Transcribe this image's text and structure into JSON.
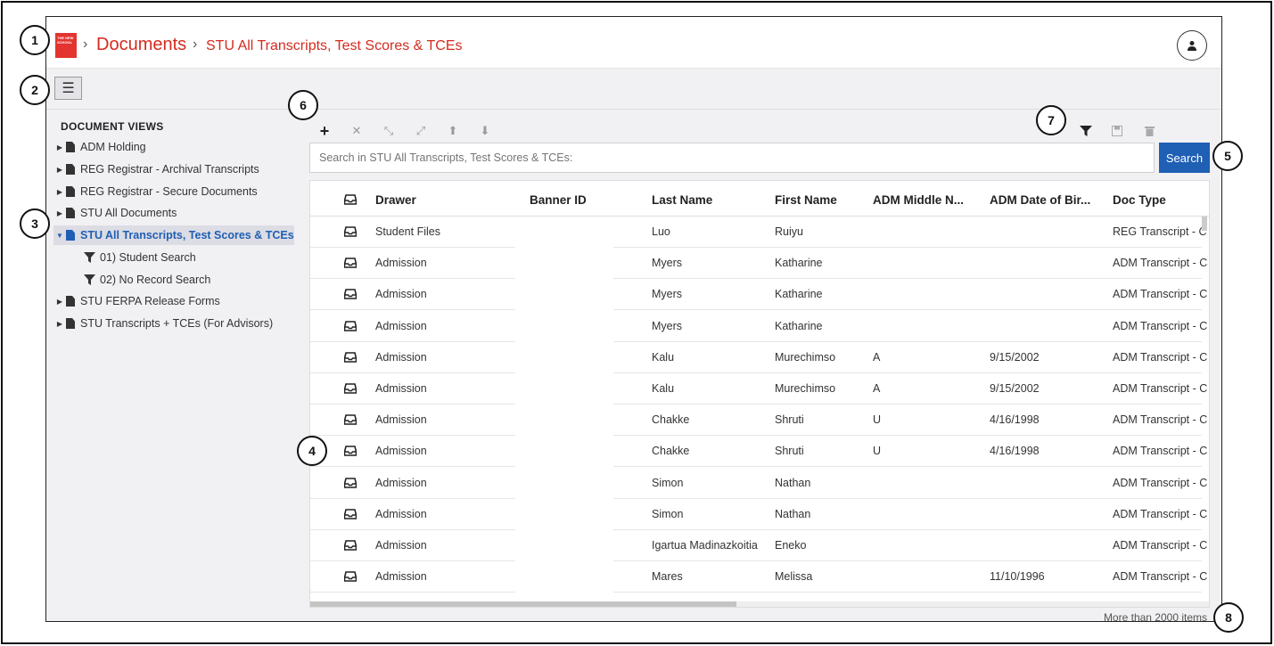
{
  "header": {
    "logo_text": "THE NEW SCHOOL",
    "breadcrumb_root": "Documents",
    "breadcrumb_current": "STU All Transcripts, Test Scores & TCEs",
    "separator": "›"
  },
  "sidebar": {
    "title": "DOCUMENT VIEWS",
    "items": [
      {
        "label": "ADM Holding"
      },
      {
        "label": "REG Registrar - Archival Transcripts"
      },
      {
        "label": "REG Registrar - Secure Documents"
      },
      {
        "label": "STU All Documents"
      },
      {
        "label": "STU All Transcripts, Test Scores & TCEs"
      },
      {
        "label": "01) Student Search"
      },
      {
        "label": "02) No Record Search"
      },
      {
        "label": "STU FERPA Release Forms"
      },
      {
        "label": "STU Transcripts + TCEs (For Advisors)"
      }
    ]
  },
  "search": {
    "placeholder": "Search in STU All Transcripts, Test Scores & TCEs:",
    "button_label": "Search"
  },
  "grid": {
    "columns": [
      "Drawer",
      "Banner ID",
      "Last Name",
      "First Name",
      "ADM Middle N...",
      "ADM Date of Bir...",
      "Doc Type"
    ],
    "rows": [
      [
        "Student Files",
        "",
        "Luo",
        "Ruiyu",
        "",
        "",
        "REG Transcript - C"
      ],
      [
        "Admission",
        "",
        "Myers",
        "Katharine",
        "",
        "",
        "ADM Transcript - C"
      ],
      [
        "Admission",
        "",
        "Myers",
        "Katharine",
        "",
        "",
        "ADM Transcript - C"
      ],
      [
        "Admission",
        "",
        "Myers",
        "Katharine",
        "",
        "",
        "ADM Transcript - C"
      ],
      [
        "Admission",
        "",
        "Kalu",
        "Murechimso",
        "A",
        "9/15/2002",
        "ADM Transcript - C"
      ],
      [
        "Admission",
        "",
        "Kalu",
        "Murechimso",
        "A",
        "9/15/2002",
        "ADM Transcript - C"
      ],
      [
        "Admission",
        "",
        "Chakke",
        "Shruti",
        "U",
        "4/16/1998",
        "ADM Transcript - C"
      ],
      [
        "Admission",
        "",
        "Chakke",
        "Shruti",
        "U",
        "4/16/1998",
        "ADM Transcript - C"
      ],
      [
        "Admission",
        "",
        "Simon",
        "Nathan",
        "",
        "",
        "ADM Transcript - C"
      ],
      [
        "Admission",
        "",
        "Simon",
        "Nathan",
        "",
        "",
        "ADM Transcript - C"
      ],
      [
        "Admission",
        "",
        "Igartua Madinazkoitia",
        "Eneko",
        "",
        "",
        "ADM Transcript - C"
      ],
      [
        "Admission",
        "",
        "Mares",
        "Melissa",
        "",
        "11/10/1996",
        "ADM Transcript - C"
      ]
    ],
    "status": "More than 2000 items"
  },
  "callouts": [
    "1",
    "2",
    "3",
    "4",
    "5",
    "6",
    "7",
    "8"
  ],
  "icons": {
    "add": "plus-icon",
    "remove": "close-icon",
    "collapse": "collapse-icon",
    "expand": "expand-icon",
    "up": "arrow-up-icon",
    "down": "arrow-down-icon",
    "filter": "filter-icon",
    "save": "save-icon",
    "delete": "trash-icon"
  },
  "colors": {
    "accent": "#1f5fb4",
    "brand": "#d52b1e"
  }
}
